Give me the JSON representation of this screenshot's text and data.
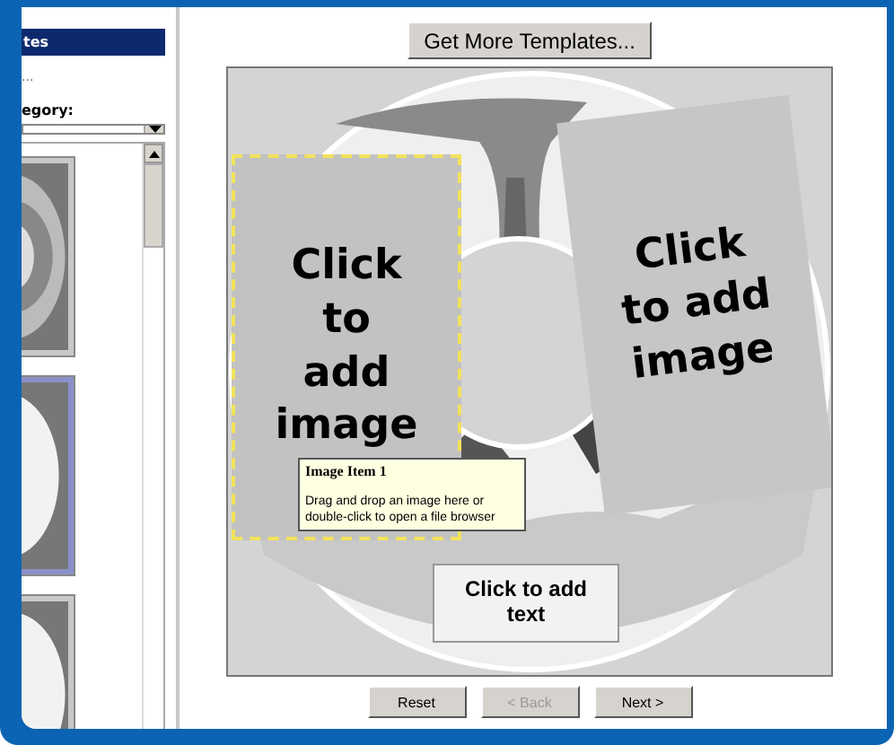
{
  "sidebar": {
    "title": "tes",
    "link": "...",
    "category_label": "egory:",
    "templates": [
      {
        "selected": false
      },
      {
        "selected": true
      },
      {
        "selected": false
      }
    ]
  },
  "get_more_button": "Get More Templates...",
  "canvas": {
    "image_slots": [
      {
        "text": "Click to add image",
        "selected": true
      },
      {
        "text": "Click to add image",
        "selected": false
      }
    ],
    "tooltip": {
      "title": "Image Item 1",
      "body": "Drag and drop an image here or double-click to open a file browser"
    },
    "text_slot": "Click to add text"
  },
  "buttons": [
    {
      "label": "Reset",
      "disabled": false
    },
    {
      "label": "< Back",
      "disabled": true
    },
    {
      "label": "Next >",
      "disabled": false
    }
  ]
}
